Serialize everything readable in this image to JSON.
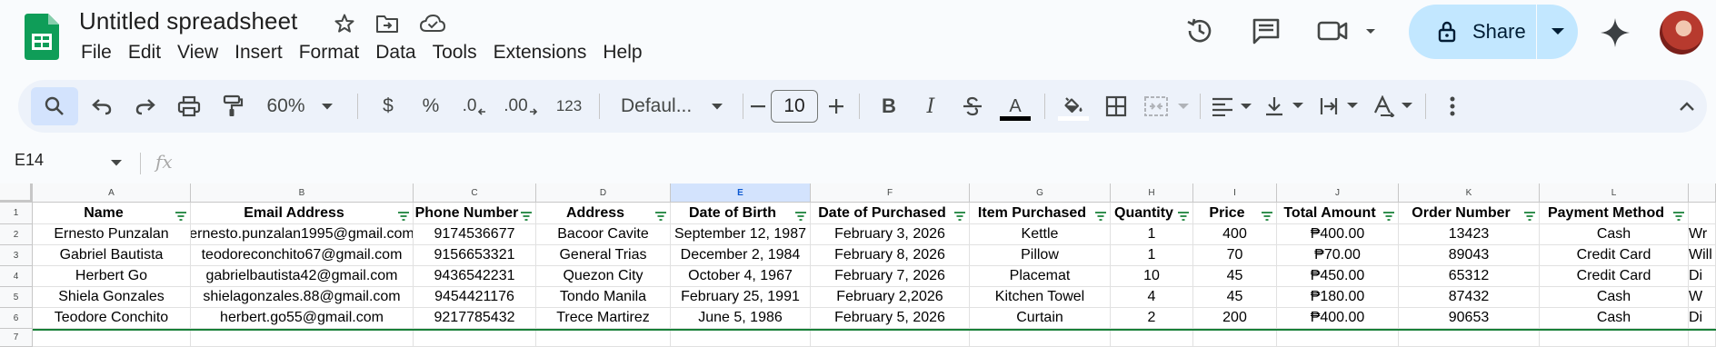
{
  "app": {
    "title": "Untitled spreadsheet",
    "menu": [
      "File",
      "Edit",
      "View",
      "Insert",
      "Format",
      "Data",
      "Tools",
      "Extensions",
      "Help"
    ],
    "share_label": "Share",
    "accent": "#c2e7ff",
    "sheets_green": "#0f9d58"
  },
  "toolbar": {
    "zoom": "60%",
    "currency": "$",
    "percent": "%",
    "dec_decrease": ".0",
    "dec_increase": ".00",
    "number_format": "123",
    "font": "Defaul...",
    "font_size": "10",
    "bold": "B",
    "italic": "I",
    "text_color_glyph": "A"
  },
  "formula_bar": {
    "name_box": "E14",
    "fx": "fx",
    "value": ""
  },
  "sheet": {
    "columns": [
      "A",
      "B",
      "C",
      "D",
      "E",
      "F",
      "G",
      "H",
      "I",
      "J",
      "K",
      "L"
    ],
    "active_column": "E",
    "row_numbers": [
      "1",
      "2",
      "3",
      "4",
      "5",
      "6",
      "7"
    ],
    "headers": [
      "Name",
      "Email Address",
      "Phone Number",
      "Address",
      "Date of Birth",
      "Date of Purchased",
      "Item Purchased",
      "Quantity",
      "Price",
      "Total Amount",
      "Order Number",
      "Payment Method"
    ],
    "rows": [
      [
        "Ernesto Punzalan",
        "ernesto.punzalan1995@gmail.com",
        "9174536677",
        "Bacoor Cavite",
        "September 12, 1987",
        "February 3, 2026",
        "Kettle",
        "1",
        "400",
        "₱400.00",
        "13423",
        "Cash",
        "Wr"
      ],
      [
        "Gabriel Bautista",
        "teodoreconchito67@gmail.com",
        "9156653321",
        "General Trias",
        "December 2, 1984",
        "February 8, 2026",
        "Pillow",
        "1",
        "70",
        "₱70.00",
        "89043",
        "Credit Card",
        "Will"
      ],
      [
        "Herbert Go",
        "gabrielbautista42@gmail.com",
        "9436542231",
        "Quezon City",
        "October 4, 1967",
        "February 7, 2026",
        "Placemat",
        "10",
        "45",
        "₱450.00",
        "65312",
        "Credit Card",
        "Di"
      ],
      [
        "Shiela Gonzales",
        "shielagonzales.88@gmail.com",
        "9454421176",
        "Tondo Manila",
        "February 25, 1991",
        "February 2,2026",
        "Kitchen Towel",
        "4",
        "45",
        "₱180.00",
        "87432",
        "Cash",
        "W"
      ],
      [
        "Teodore Conchito",
        "herbert.go55@gmail.com",
        "9217785432",
        "Trece Martirez",
        "June 5, 1986",
        "February 5, 2026",
        "Curtain",
        "2",
        "200",
        "₱400.00",
        "90653",
        "Cash",
        "Di"
      ]
    ]
  }
}
